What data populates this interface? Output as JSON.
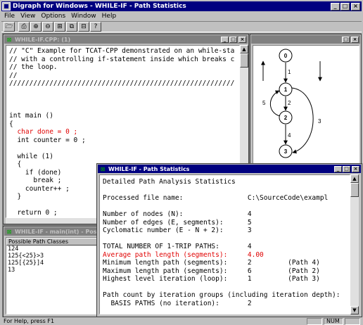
{
  "app": {
    "title": "Digraph for Windows - WHILE-IF - Path Statistics"
  },
  "menu": [
    "File",
    "View",
    "Options",
    "Window",
    "Help"
  ],
  "toolbar": {
    "icons": [
      "open-icon",
      "print-icon",
      "zoom-in-icon",
      "zoom-out-icon",
      "tile-icon",
      "cascade-icon",
      "arrange-icon",
      "help-icon"
    ],
    "glyphs": [
      "🗁",
      "⎙",
      "⊕",
      "⊖",
      "⊞",
      "⧉",
      "⊟",
      "?"
    ]
  },
  "code_window": {
    "title": "WHILE-IF.CPP: (1)",
    "lines": [
      {
        "text": "// \"C\" Example for TCAT-CPP demonstrated on an while-sta",
        "hl": false
      },
      {
        "text": "// with a controlling if-statement inside which breaks c",
        "hl": false
      },
      {
        "text": "// the loop.",
        "hl": false
      },
      {
        "text": "//",
        "hl": false
      },
      {
        "text": "////////////////////////////////////////////////////////",
        "hl": false
      },
      {
        "text": "",
        "hl": false
      },
      {
        "text": "",
        "hl": false
      },
      {
        "text": "",
        "hl": false
      },
      {
        "text": "int main ()",
        "hl": false
      },
      {
        "text": "{",
        "hl": false
      },
      {
        "text": "  char done = 0 ;",
        "hl": true
      },
      {
        "text": "  int counter = 0 ;",
        "hl": false
      },
      {
        "text": "",
        "hl": false
      },
      {
        "text": "  while (1)",
        "hl": false
      },
      {
        "text": "  {",
        "hl": false
      },
      {
        "text": "    if (done)",
        "hl": false
      },
      {
        "text": "      break ;",
        "hl": false
      },
      {
        "text": "    counter++ ;",
        "hl": false
      },
      {
        "text": "  }",
        "hl": false
      },
      {
        "text": "",
        "hl": false
      },
      {
        "text": "  return 0 ;",
        "hl": false
      },
      {
        "text": "}",
        "hl": false
      }
    ]
  },
  "graph_window": {
    "title": "",
    "nodes": [
      "0",
      "1",
      "2",
      "3"
    ],
    "edge_labels": [
      "1",
      "2",
      "3",
      "4",
      "5"
    ]
  },
  "classes_window": {
    "title": "WHILE-IF - main(int) - Possible",
    "header": "Possible Path Classes",
    "rows": [
      "124",
      "125{<25}>3",
      "125[{25}]4",
      "13"
    ]
  },
  "stats_window": {
    "title": "WHILE-IF - Path Statistics",
    "lines": [
      {
        "text": "Detailed Path Analysis Statistics",
        "hl": false
      },
      {
        "text": "",
        "hl": false
      },
      {
        "text": "Processed file name:                C:\\SourceCode\\exampl",
        "hl": false
      },
      {
        "text": "",
        "hl": false
      },
      {
        "text": "Number of nodes (N):                4",
        "hl": false
      },
      {
        "text": "Number of edges (E, segments):      5",
        "hl": false
      },
      {
        "text": "Cyclomatic number (E - N + 2):      3",
        "hl": false
      },
      {
        "text": "",
        "hl": false
      },
      {
        "text": "TOTAL NUMBER OF 1-TRIP PATHS:       4",
        "hl": false
      },
      {
        "text": "Average path length (segments):     4.00",
        "hl": true
      },
      {
        "text": "Minimum length path (segments):     2         (Path 4)",
        "hl": false
      },
      {
        "text": "Maximum length path (segments):     6         (Path 2)",
        "hl": false
      },
      {
        "text": "Highest level iteration (loop):     1         (Path 3)",
        "hl": false
      },
      {
        "text": "",
        "hl": false
      },
      {
        "text": "Path count by iteration groups (including iteration depth):",
        "hl": false
      },
      {
        "text": "  BASIS PATHS (no iteration):       2",
        "hl": false
      }
    ]
  },
  "status": {
    "message": "For Help, press F1",
    "num": "NUM"
  }
}
